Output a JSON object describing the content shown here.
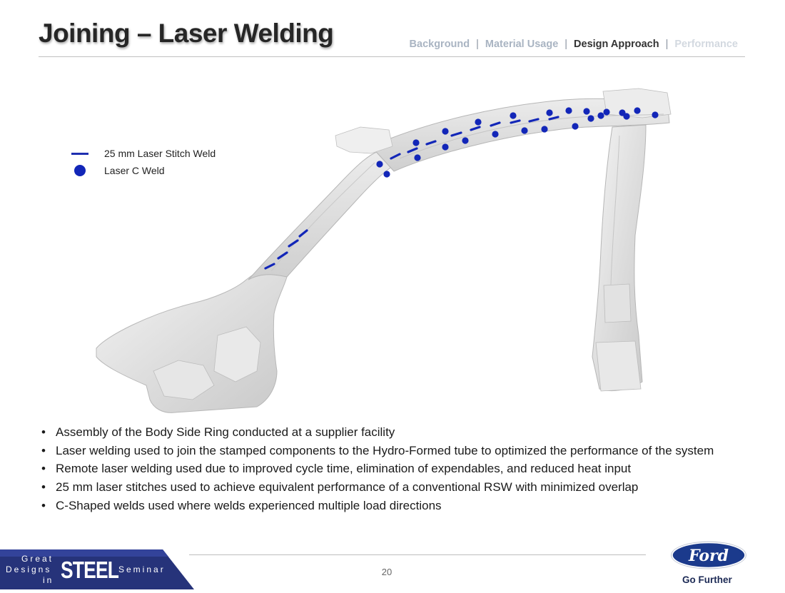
{
  "slide": {
    "title": "Joining – Laser Welding",
    "page_number": "20"
  },
  "nav": {
    "items": [
      "Background",
      "Material Usage",
      "Design Approach",
      "Performance"
    ],
    "separator": "|",
    "active": "Design Approach"
  },
  "legend": {
    "stitch_label": "25 mm Laser Stitch Weld",
    "cweld_label": "Laser C Weld",
    "weld_color": "#1226b8"
  },
  "bullets": [
    "Assembly of the Body Side Ring conducted at a supplier facility",
    "Laser welding used to join the  stamped components to the Hydro-Formed tube to optimized the performance of the system",
    "Remote laser welding used due to improved cycle time, elimination of expendables, and reduced heat input",
    "25 mm laser stitches used to achieve equivalent performance of a conventional RSW with minimized overlap",
    "C-Shaped welds used where welds experienced multiple load directions"
  ],
  "footer_logo": {
    "line1": "Great",
    "line2": "Designs",
    "line3": "in",
    "steel": "STEEL",
    "seminar": "Seminar",
    "bg_color": "#26337a"
  },
  "ford_logo": {
    "wordmark": "Ford",
    "tagline": "Go Further",
    "oval_color": "#1b3a8c"
  }
}
